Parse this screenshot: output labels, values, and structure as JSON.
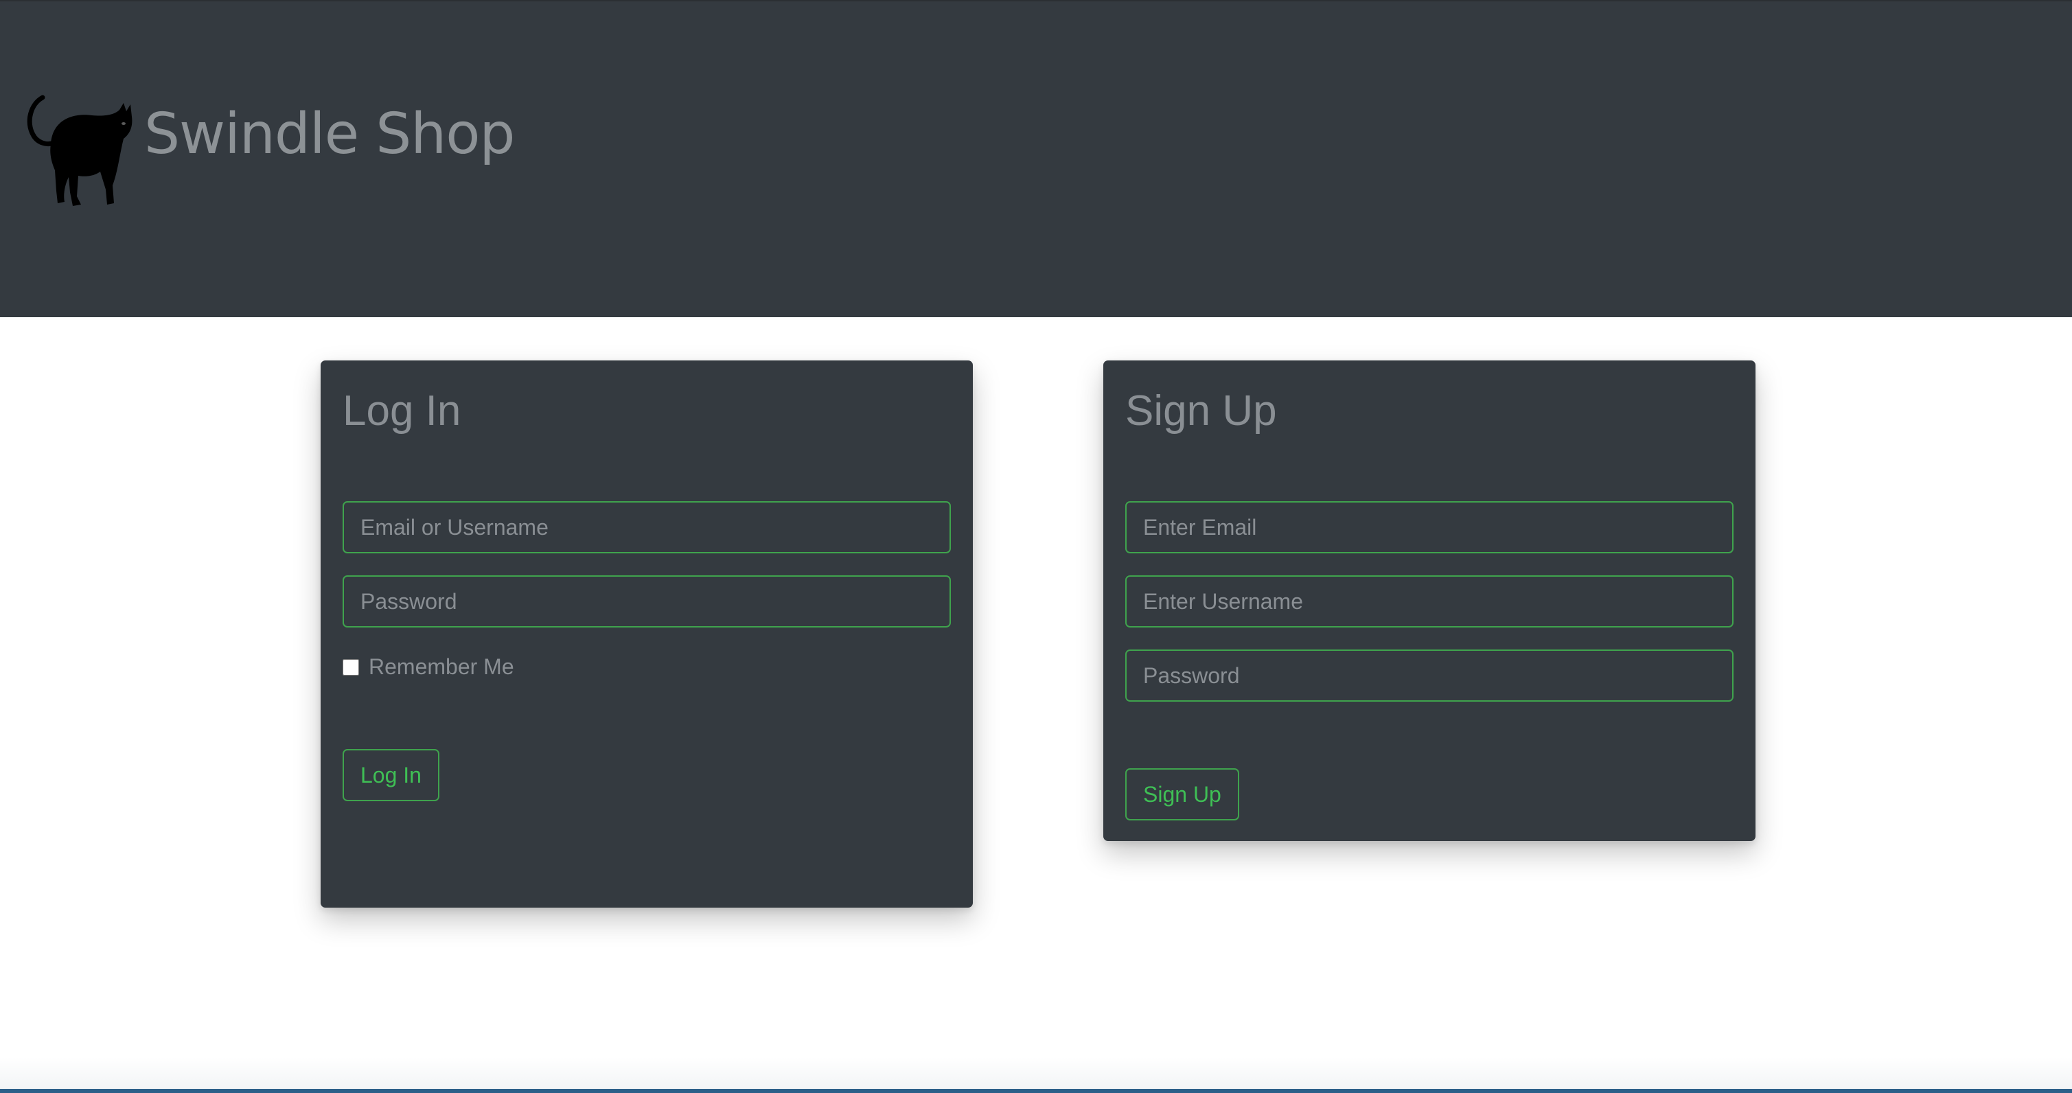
{
  "header": {
    "brand_name": "Swindle Shop",
    "logo_icon": "black-cat-icon"
  },
  "login": {
    "title": "Log In",
    "identifier_placeholder": "Email or Username",
    "password_placeholder": "Password",
    "remember_label": "Remember Me",
    "remember_checked": false,
    "submit_label": "Log In"
  },
  "signup": {
    "title": "Sign Up",
    "email_placeholder": "Enter Email",
    "username_placeholder": "Enter Username",
    "password_placeholder": "Password",
    "submit_label": "Sign Up"
  },
  "colors": {
    "header_bg": "#343a40",
    "card_bg": "#343a40",
    "accent_green": "#3fa34d",
    "muted_text": "#8a8f94"
  }
}
